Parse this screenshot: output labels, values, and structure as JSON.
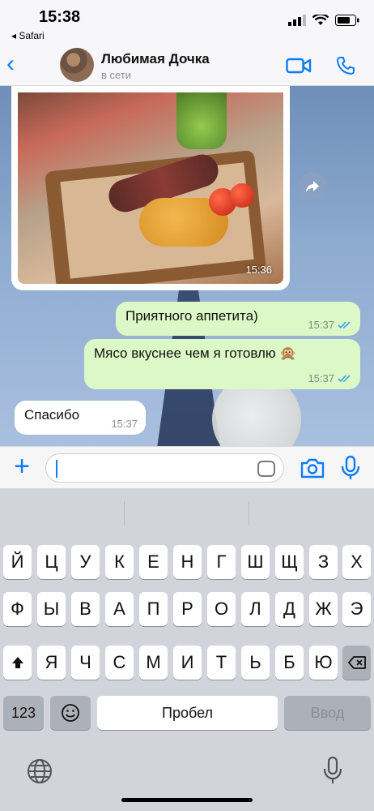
{
  "status_bar": {
    "time": "15:38",
    "back_app": "◂ Safari"
  },
  "header": {
    "name": "Любимая Дочка",
    "status": "в сети"
  },
  "messages": {
    "image_time": "15:36",
    "out1": {
      "text": "Приятного аппетита)",
      "time": "15:37"
    },
    "out2": {
      "text": "Мясо вкуснее чем я готовлю 🙊",
      "time": "15:37"
    },
    "in1": {
      "text": "Спасибо",
      "time": "15:37"
    }
  },
  "keyboard": {
    "row1": [
      "Й",
      "Ц",
      "У",
      "К",
      "Е",
      "Н",
      "Г",
      "Ш",
      "Щ",
      "З",
      "Х"
    ],
    "row2": [
      "Ф",
      "Ы",
      "В",
      "А",
      "П",
      "Р",
      "О",
      "Л",
      "Д",
      "Ж",
      "Э"
    ],
    "row3": [
      "Я",
      "Ч",
      "С",
      "М",
      "И",
      "Т",
      "Ь",
      "Б",
      "Ю"
    ],
    "numbers_label": "123",
    "space_label": "Пробел",
    "return_label": "Ввод"
  },
  "colors": {
    "accent": "#0a7cff",
    "outgoing": "#dcf8c6",
    "incoming": "#ffffff"
  }
}
